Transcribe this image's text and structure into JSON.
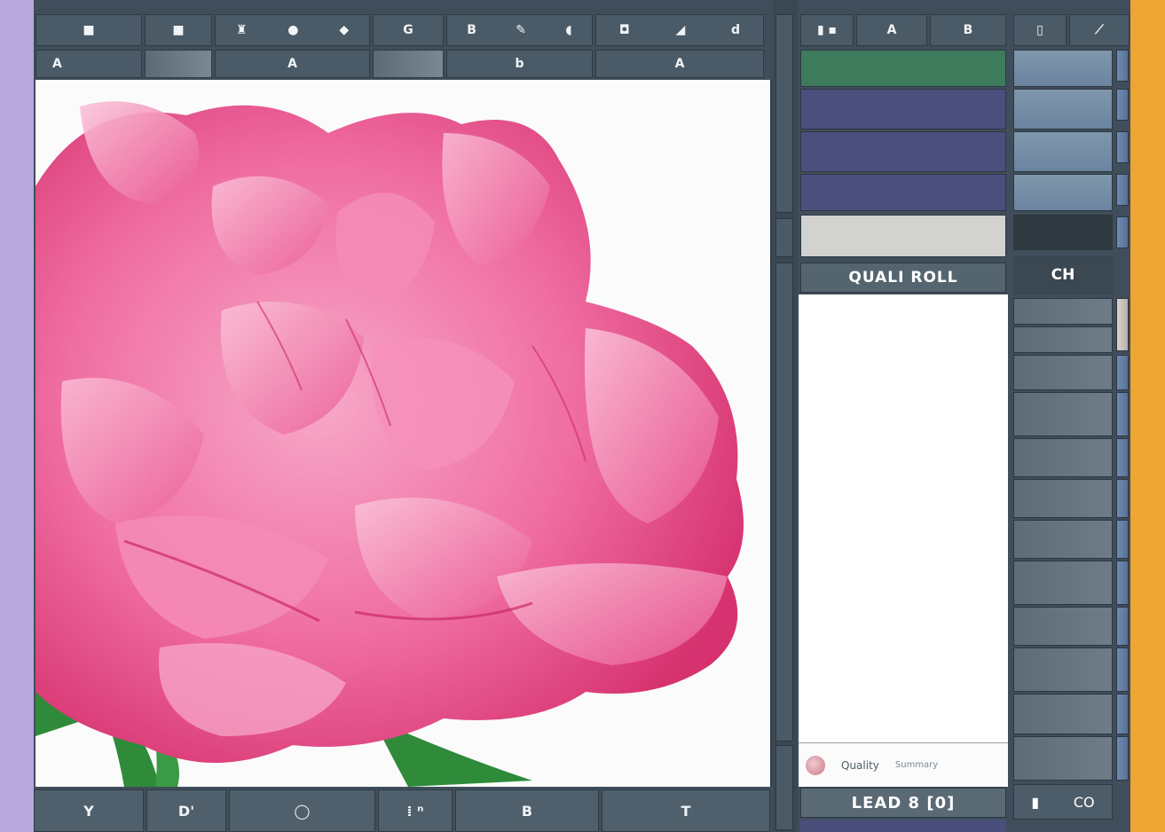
{
  "toolbar_top": {
    "row1": [
      {
        "glyphs": [
          "■"
        ]
      },
      {
        "glyphs": [
          "■"
        ]
      },
      {
        "glyphs": [
          "♜",
          "●",
          "◆"
        ]
      },
      {
        "glyphs": [
          "G"
        ]
      },
      {
        "glyphs": [
          "B",
          "✎",
          "◖"
        ]
      },
      {
        "glyphs": [
          "◘",
          "◢",
          "d"
        ]
      }
    ],
    "row2": [
      "A",
      "",
      "A",
      "",
      "b",
      "A"
    ]
  },
  "panel": {
    "toolbar": [
      "▮ ▪",
      "A",
      "B"
    ],
    "header_label": "QUALI ROLL",
    "footer_text": "Quality",
    "footer_muted": "Summary",
    "bottom_label": "LEAD 8 [0]"
  },
  "side": {
    "toolbar": [
      "▯",
      "⟋"
    ],
    "header_label": "CH",
    "foot_icons": [
      "▮",
      "CO"
    ]
  },
  "bottom_toolbar": [
    "Y",
    "D'",
    "◯",
    "⁞ ⁿ",
    "B",
    "T"
  ],
  "colors": {
    "petal_main": "#f06ea2",
    "petal_light": "#f7a8c8",
    "petal_dark": "#d6326f",
    "leaf": "#2f8a3a",
    "panel_green": "#3e7a5c",
    "panel_purple": "#4a4f7e",
    "frame_left": "#b8a8de",
    "frame_right": "#eda533"
  }
}
